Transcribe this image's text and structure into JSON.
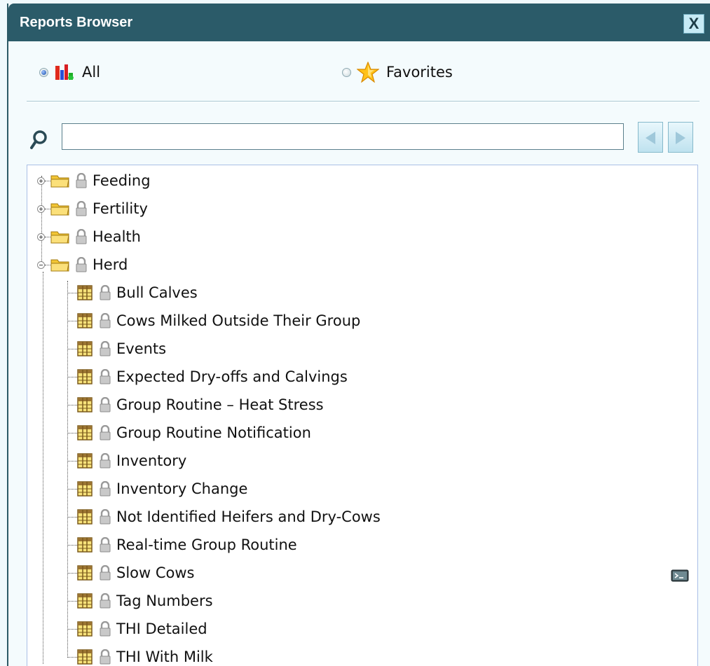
{
  "window": {
    "title": "Reports Browser",
    "close_label": "X"
  },
  "filter": {
    "all_label": "All",
    "favorites_label": "Favorites",
    "selected": "All"
  },
  "search": {
    "value": "",
    "placeholder": ""
  },
  "tree": {
    "folders": [
      {
        "label": "Feeding",
        "expanded": false
      },
      {
        "label": "Fertility",
        "expanded": false
      },
      {
        "label": "Health",
        "expanded": false
      },
      {
        "label": "Herd",
        "expanded": true
      }
    ],
    "herd_reports": [
      "Bull Calves",
      "Cows Milked Outside Their Group",
      "Events",
      "Expected Dry-offs and Calvings",
      "Group Routine – Heat Stress",
      "Group Routine Notification",
      "Inventory",
      "Inventory Change",
      "Not Identified Heifers and Dry-Cows",
      "Real-time Group Routine",
      "Slow Cows",
      "Tag Numbers",
      "THI Detailed",
      "THI With Milk"
    ]
  },
  "colors": {
    "titlebar": "#2b5b69",
    "background": "#f4fbfd",
    "folder": "#f7d64a",
    "report_icon": "#8b6a2e",
    "lock": "#b9b9b9"
  },
  "icons": {
    "all": "bar-chart-icon",
    "favorites": "star-icon",
    "search": "search-icon",
    "folder": "folder-icon",
    "report": "report-grid-icon",
    "lock": "lock-icon",
    "console": "console-icon"
  }
}
